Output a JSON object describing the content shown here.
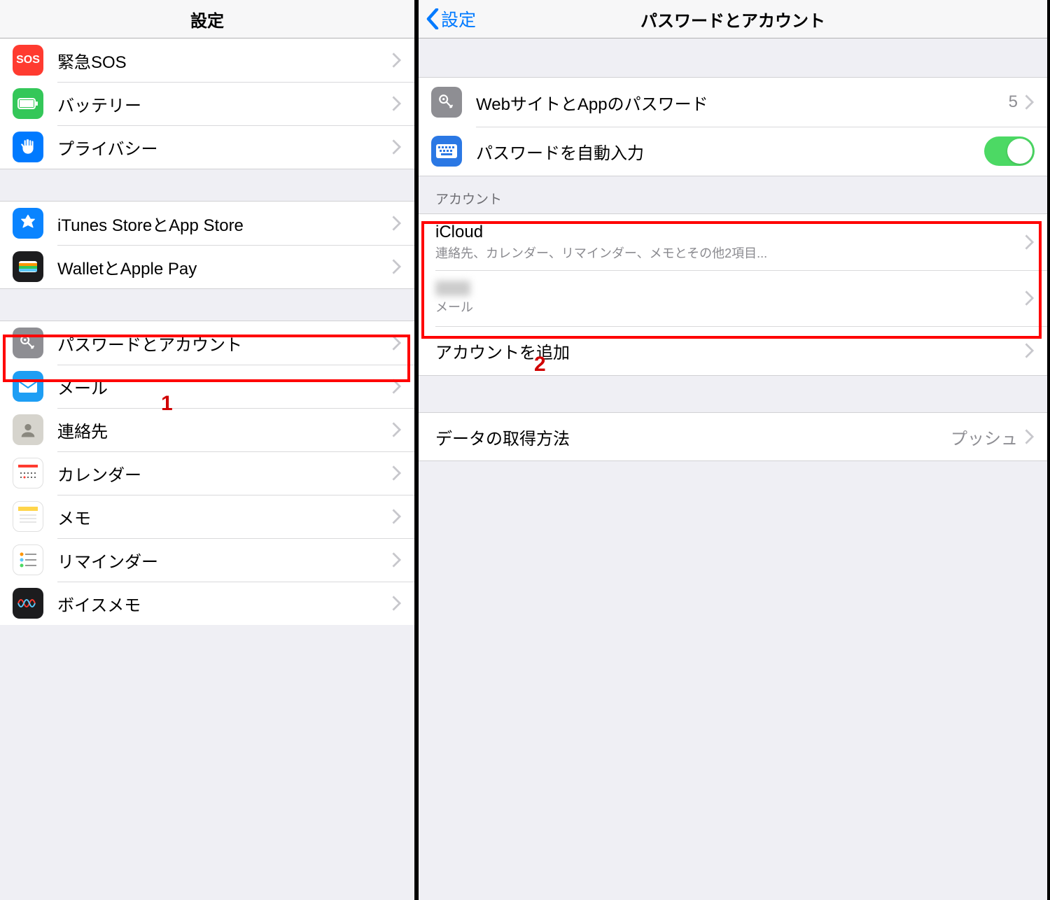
{
  "left": {
    "title": "設定",
    "items": [
      {
        "id": "sos",
        "label": "緊急SOS"
      },
      {
        "id": "battery",
        "label": "バッテリー"
      },
      {
        "id": "privacy",
        "label": "プライバシー"
      }
    ],
    "items2": [
      {
        "id": "itunes",
        "label": "iTunes StoreとApp Store"
      },
      {
        "id": "wallet",
        "label": "WalletとApple Pay"
      }
    ],
    "items3": [
      {
        "id": "passwords",
        "label": "パスワードとアカウント"
      },
      {
        "id": "mail",
        "label": "メール"
      },
      {
        "id": "contacts",
        "label": "連絡先"
      },
      {
        "id": "calendar",
        "label": "カレンダー"
      },
      {
        "id": "notes",
        "label": "メモ"
      },
      {
        "id": "reminders",
        "label": "リマインダー"
      },
      {
        "id": "voicememo",
        "label": "ボイスメモ"
      }
    ],
    "annotation1": "1"
  },
  "right": {
    "back": "設定",
    "title": "パスワードとアカウント",
    "passwords_row": {
      "label": "WebサイトとAppのパスワード",
      "count": "5"
    },
    "autofill_row": {
      "label": "パスワードを自動入力",
      "on": true
    },
    "accounts_header": "アカウント",
    "accounts": [
      {
        "title": "iCloud",
        "sub": "連絡先、カレンダー、リマインダー、メモとその他2項目..."
      },
      {
        "title": "",
        "sub": "メール",
        "blurred": true
      }
    ],
    "add_account": "アカウントを追加",
    "fetch": {
      "label": "データの取得方法",
      "value": "プッシュ"
    },
    "annotation2": "2"
  }
}
